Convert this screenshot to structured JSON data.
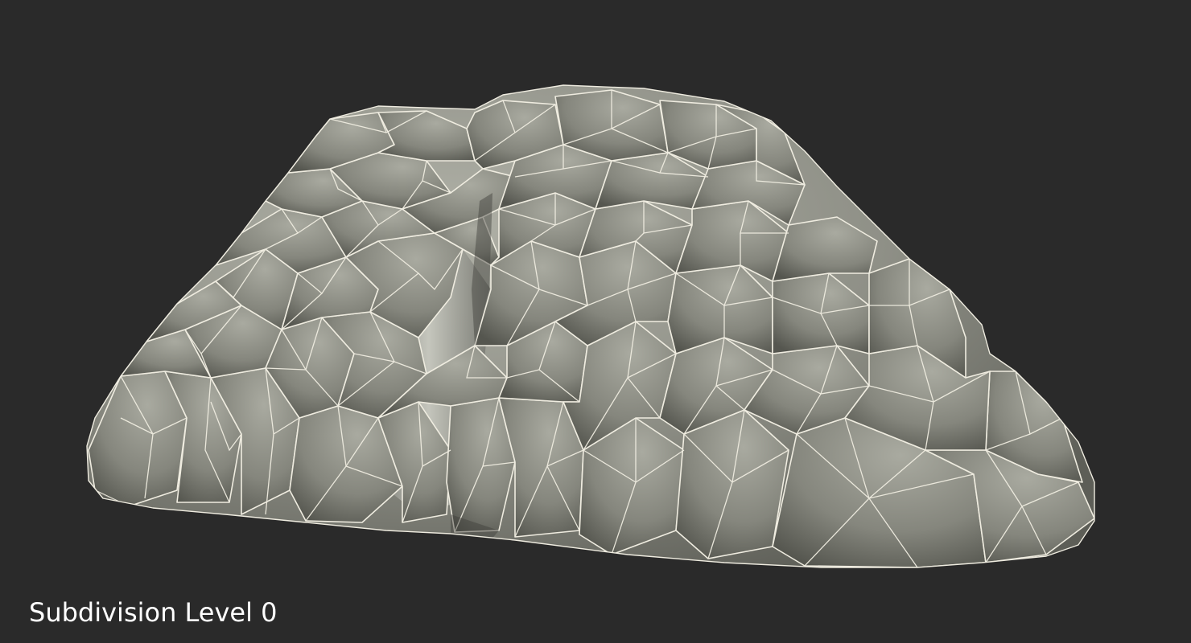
{
  "caption": "Subdivision Level 0",
  "colors": {
    "background": "#2a2a2a",
    "rock_base": "#8c8d84",
    "rock_light": "#a7a89e",
    "rock_dark": "#5b5c55",
    "wire": "#f4f1e4"
  }
}
